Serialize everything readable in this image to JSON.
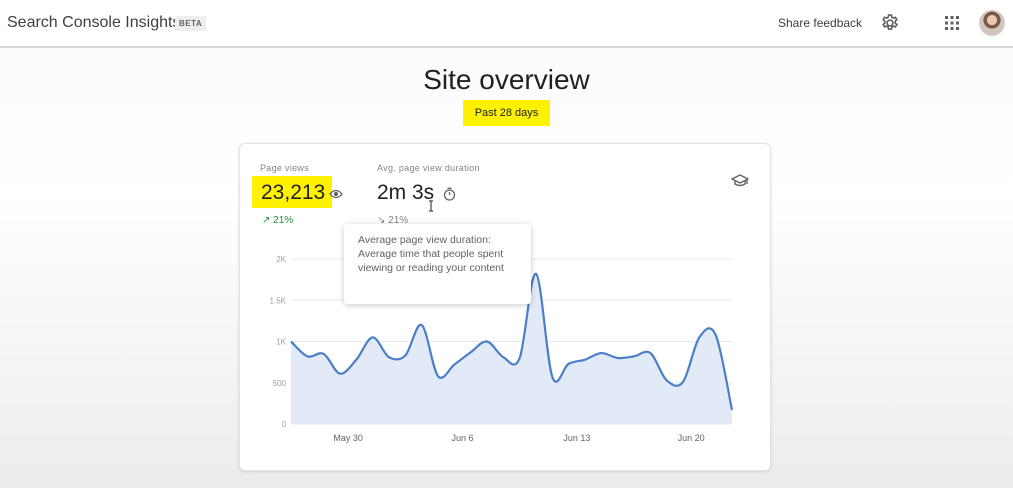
{
  "header": {
    "app_title": "Search Console Insights",
    "beta_badge": "BETA",
    "share_feedback": "Share feedback",
    "icons": [
      "gear-icon",
      "apps-grid-icon",
      "avatar"
    ]
  },
  "page": {
    "title": "Site overview",
    "date_range": "Past 28 days",
    "highlight_color": "#fff200"
  },
  "metrics": {
    "page_views": {
      "label": "Page views",
      "value": "23,213",
      "change": "21%",
      "icon": "eye-icon"
    },
    "avg_duration": {
      "label": "Avg. page view duration",
      "value": "2m 3s",
      "change": "21%",
      "icon": "timer-icon"
    }
  },
  "tooltip": {
    "text": "Average page view duration: Average time that people spent viewing or reading your content"
  },
  "chart_data": {
    "type": "area",
    "ylim": [
      0,
      2000
    ],
    "y_ticks": [
      "0",
      "500",
      "1K",
      "1.5K",
      "2K"
    ],
    "x_ticks": [
      "May 30",
      "Jun 6",
      "Jun 13",
      "Jun 20"
    ],
    "x_tick_positions": [
      3.5,
      10.5,
      17.5,
      24.5
    ],
    "series": [
      {
        "color": "#4a7fc8",
        "values": [
          1000,
          820,
          850,
          610,
          780,
          1050,
          810,
          830,
          1200,
          580,
          720,
          870,
          1000,
          810,
          800,
          1820,
          570,
          730,
          780,
          860,
          800,
          820,
          860,
          530,
          510,
          1050,
          1080,
          170
        ]
      }
    ]
  }
}
